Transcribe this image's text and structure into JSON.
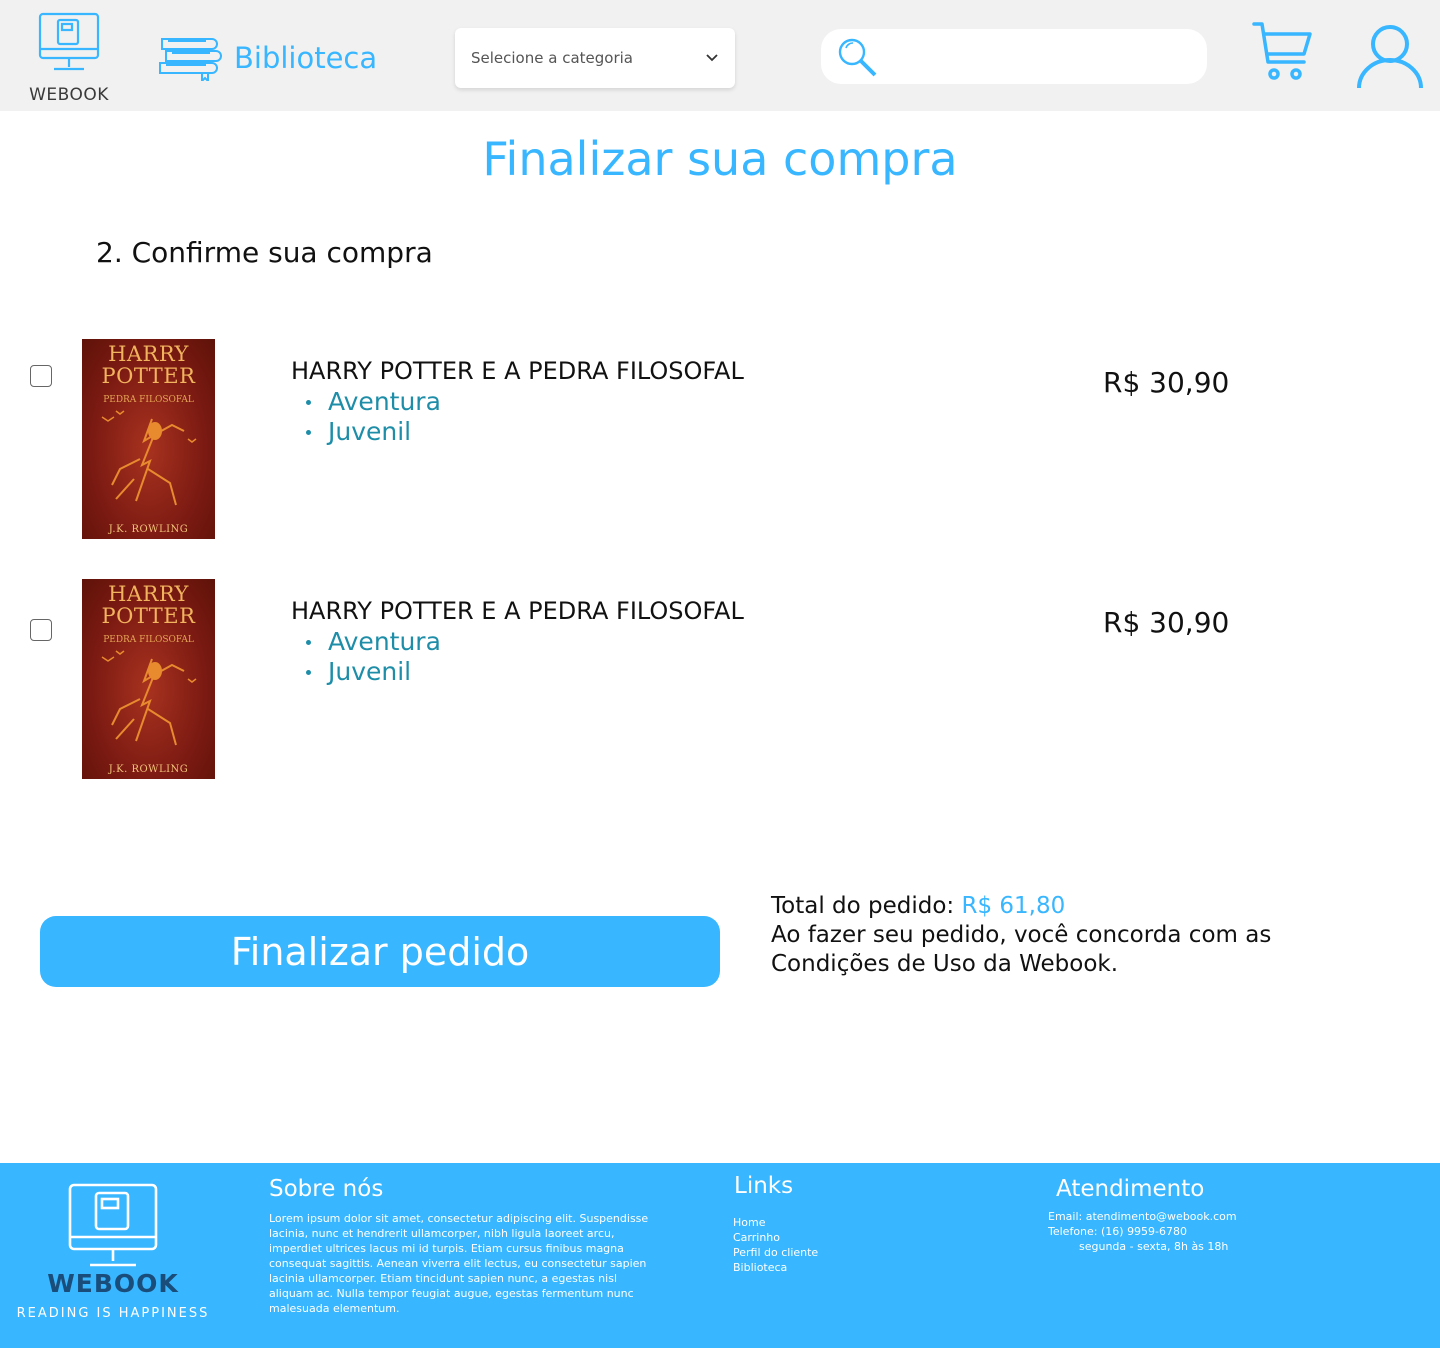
{
  "header": {
    "logo_text": "WEBOOK",
    "library_label": "Biblioteca",
    "category_placeholder": "Selecione a categoria",
    "search_value": ""
  },
  "main": {
    "title": "Finalizar sua compra",
    "step_title": "2. Confirme sua compra",
    "items": [
      {
        "cover_title_1": "HARRY",
        "cover_title_2": "POTTER",
        "cover_subtitle": "PEDRA FILOSOFAL",
        "cover_author": "J.K. ROWLING",
        "title": "HARRY POTTER E A PEDRA FILOSOFAL",
        "tags": [
          "Aventura",
          "Juvenil"
        ],
        "price": "R$ 30,90",
        "checked": false
      },
      {
        "cover_title_1": "HARRY",
        "cover_title_2": "POTTER",
        "cover_subtitle": "PEDRA FILOSOFAL",
        "cover_author": "J.K. ROWLING",
        "title": "HARRY POTTER E A PEDRA FILOSOFAL",
        "tags": [
          "Aventura",
          "Juvenil"
        ],
        "price": "R$ 30,90",
        "checked": false
      }
    ],
    "finalize_button": "Finalizar pedido",
    "total_label": "Total do pedido:",
    "total_value": "R$ 61,80",
    "terms_line1": "Ao fazer seu pedido, você concorda com as",
    "terms_line2": "Condições de Uso da Webook."
  },
  "footer": {
    "logo_text": "WEBOOK",
    "tagline": "READING IS HAPPINESS",
    "about_title": "Sobre nós",
    "about_text": "Lorem ipsum dolor sit amet, consectetur adipiscing elit. Suspendisse lacinia, nunc et hendrerit ullamcorper, nibh ligula laoreet arcu, imperdiet ultrices lacus mi id turpis. Etiam cursus finibus magna consequat sagittis. Aenean viverra elit lectus, eu consectetur sapien lacinia ullamcorper. Etiam tincidunt sapien nunc, a egestas nisl aliquam ac. Nulla tempor feugiat augue, egestas fermentum nunc malesuada elementum.",
    "links_title": "Links",
    "links": [
      "Home",
      "Carrinho",
      "Perfil do cliente",
      "Biblioteca"
    ],
    "contact_title": "Atendimento",
    "contact_email": "Email: atendimento@webook.com",
    "contact_phone": "Telefone: (16) 9959-6780",
    "contact_hours": "segunda - sexta, 8h às 18h"
  },
  "colors": {
    "accent": "#38b6ff",
    "tag": "#1e8ea8",
    "header_bg": "#f1f1f1",
    "footer_logo": "#1a4d7a"
  },
  "icons": [
    "monitor-book-icon",
    "books-stack-icon",
    "chevron-down-icon",
    "search-icon",
    "cart-icon",
    "user-icon"
  ]
}
